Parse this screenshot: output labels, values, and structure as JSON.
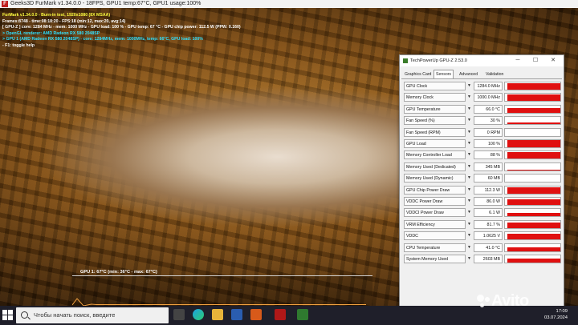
{
  "furmark": {
    "window_title": "Geeks3D FurMark v1.34.0.0 - 18FPS, GPU1 temp:67°C, GPU1 usage:100%",
    "overlay_lines": [
      {
        "text": "FurMark v1.34.0.0 - Burn-in test, 1920x1080 (8X MSAA)",
        "color": "yellow"
      },
      {
        "text": "Frames:8748 - time:08:18:20 - FPS:18 (min:12, max:20, avg:14)",
        "color": "white"
      },
      {
        "text": "[ GPU-Z ] core: 1284 MHz - mem: 1000 MHz - GPU load: 100 % - GPU temp: 67 °C - GPU chip power: 112.5 W (PPW: 0.160)",
        "color": "white"
      },
      {
        "text": "> OpenGL renderer: AMD Radeon RX 580 2048SP",
        "color": "cyan"
      },
      {
        "text": "> GPU 1 (AMD Radeon RX 580 2048SP) - core: 1284MHz, mem: 1000MHz, temp: 66°C, GPU load: 100%",
        "color": "cyan"
      },
      {
        "text": "- F1: toggle help",
        "color": "white"
      }
    ],
    "temp_graph_label": "GPU 1: 67°C (min: 36°C - max: 67°C)",
    "temp_graph_level": 0.08
  },
  "gpuz": {
    "title": "TechPowerUp GPU-Z 2.53.0",
    "controls": {
      "minimize": "─",
      "maximize": "☐",
      "close": "✕"
    },
    "tabs": [
      "Graphics Card",
      "Sensors",
      "Advanced",
      "Validation"
    ],
    "active_tab": "Sensors",
    "accent_color": "#e01010",
    "sensors": [
      {
        "name": "GPU Clock",
        "value": "1284.0 MHz",
        "level": 0.92
      },
      {
        "name": "Memory Clock",
        "value": "1000.0 MHz",
        "level": 0.95
      },
      {
        "name": "GPU Temperature",
        "value": "66.0 °C",
        "level": 0.6
      },
      {
        "name": "Fan Speed (%)",
        "value": "30 %",
        "level": 0.3
      },
      {
        "name": "Fan Speed (RPM)",
        "value": "0 RPM",
        "level": 0.0
      },
      {
        "name": "GPU Load",
        "value": "100 %",
        "level": 1.0
      },
      {
        "name": "Memory Controller Load",
        "value": "88 %",
        "level": 0.88
      },
      {
        "name": "Memory Used (Dedicated)",
        "value": "345 MB",
        "level": 0.1
      },
      {
        "name": "Memory Used (Dynamic)",
        "value": "60 MB",
        "level": 0.04
      },
      {
        "name": "GPU Chip Power Draw",
        "value": "112.3 W",
        "level": 0.9
      },
      {
        "name": "VDDC Power Draw",
        "value": "86.0 W",
        "level": 0.75
      },
      {
        "name": "VDDCI Power Draw",
        "value": "6.1 W",
        "level": 0.5
      },
      {
        "name": "VRM Efficiency",
        "value": "81.7 %",
        "level": 0.8
      },
      {
        "name": "VDDC",
        "value": "1.0625 V",
        "level": 0.85
      },
      {
        "name": "CPU Temperature",
        "value": "41.0 °C",
        "level": 0.55
      },
      {
        "name": "System Memory Used",
        "value": "2603 MB",
        "level": 0.6
      }
    ]
  },
  "taskbar": {
    "search_placeholder": "Чтобы начать поиск, введите",
    "time": "17:09",
    "date": "03.07.2024"
  },
  "watermark": "Avito"
}
